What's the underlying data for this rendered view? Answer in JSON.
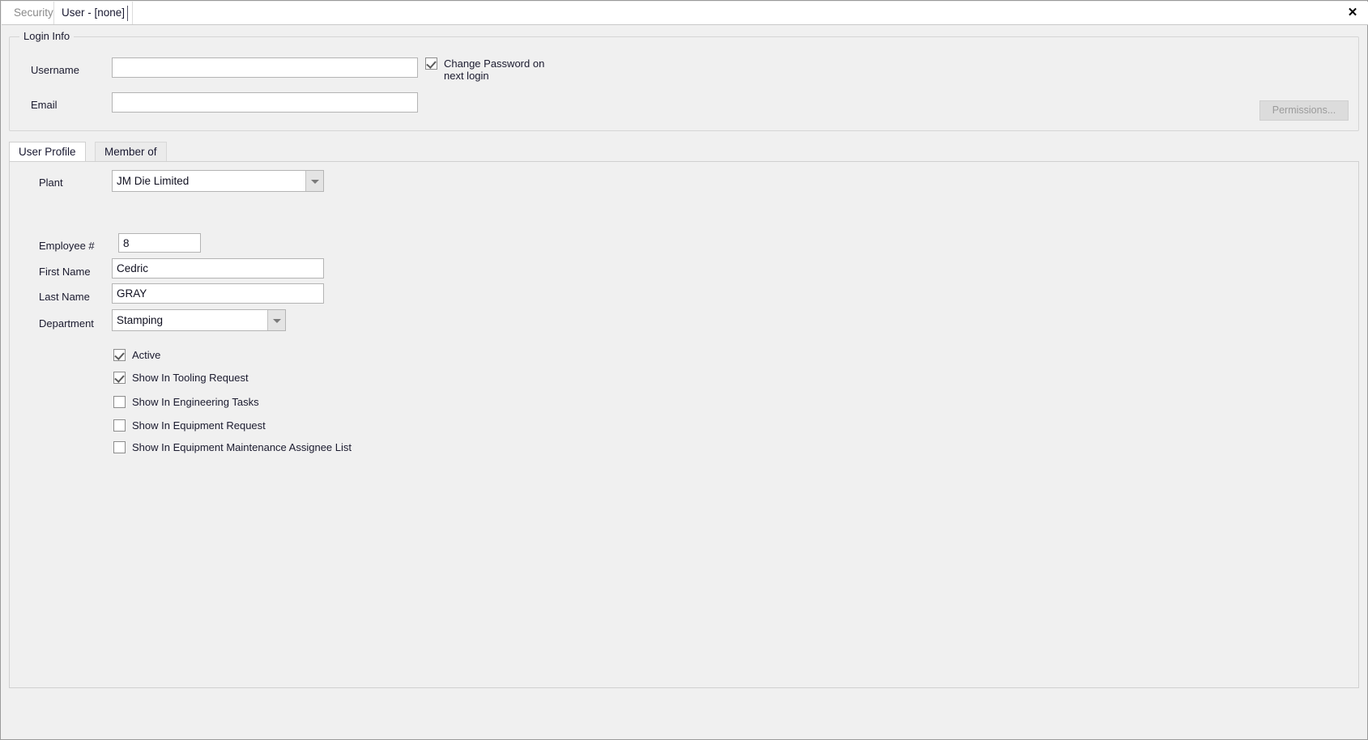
{
  "window": {
    "close_label": "✕"
  },
  "top_tabs": [
    {
      "label": "Security",
      "active": false
    },
    {
      "label": "User - [none]",
      "active": true
    }
  ],
  "login_group": {
    "title": "Login Info",
    "username": {
      "label": "Username",
      "value": "",
      "placeholder": ""
    },
    "email": {
      "label": "Email",
      "value": "",
      "placeholder": ""
    },
    "change_password": {
      "label": "Change Password on\nnext login",
      "checked": true
    },
    "permissions_button": {
      "label": "Permissions...",
      "enabled": false
    }
  },
  "inner_tabs": [
    {
      "label": "User Profile",
      "active": true
    },
    {
      "label": "Member of",
      "active": false
    }
  ],
  "user_profile": {
    "plant": {
      "label": "Plant",
      "value": "JM Die Limited"
    },
    "employee_number": {
      "label": "Employee #",
      "value": "8"
    },
    "first_name": {
      "label": "First Name",
      "value": "Cedric"
    },
    "last_name": {
      "label": "Last Name",
      "value": "GRAY"
    },
    "department": {
      "label": "Department",
      "value": "Stamping"
    },
    "options": [
      {
        "label": "Active",
        "checked": true
      },
      {
        "label": "Show In Tooling Request",
        "checked": true
      },
      {
        "label": "Show In Engineering Tasks",
        "checked": false
      },
      {
        "label": "Show In Equipment Request",
        "checked": false
      },
      {
        "label": "Show In Equipment Maintenance Assignee List",
        "checked": false
      }
    ]
  },
  "colors": {
    "background": "#f0f0f0",
    "field_border": "#b4b4b4",
    "accent_text": "#1a1a2e",
    "disabled_text": "#9b9b9b"
  }
}
